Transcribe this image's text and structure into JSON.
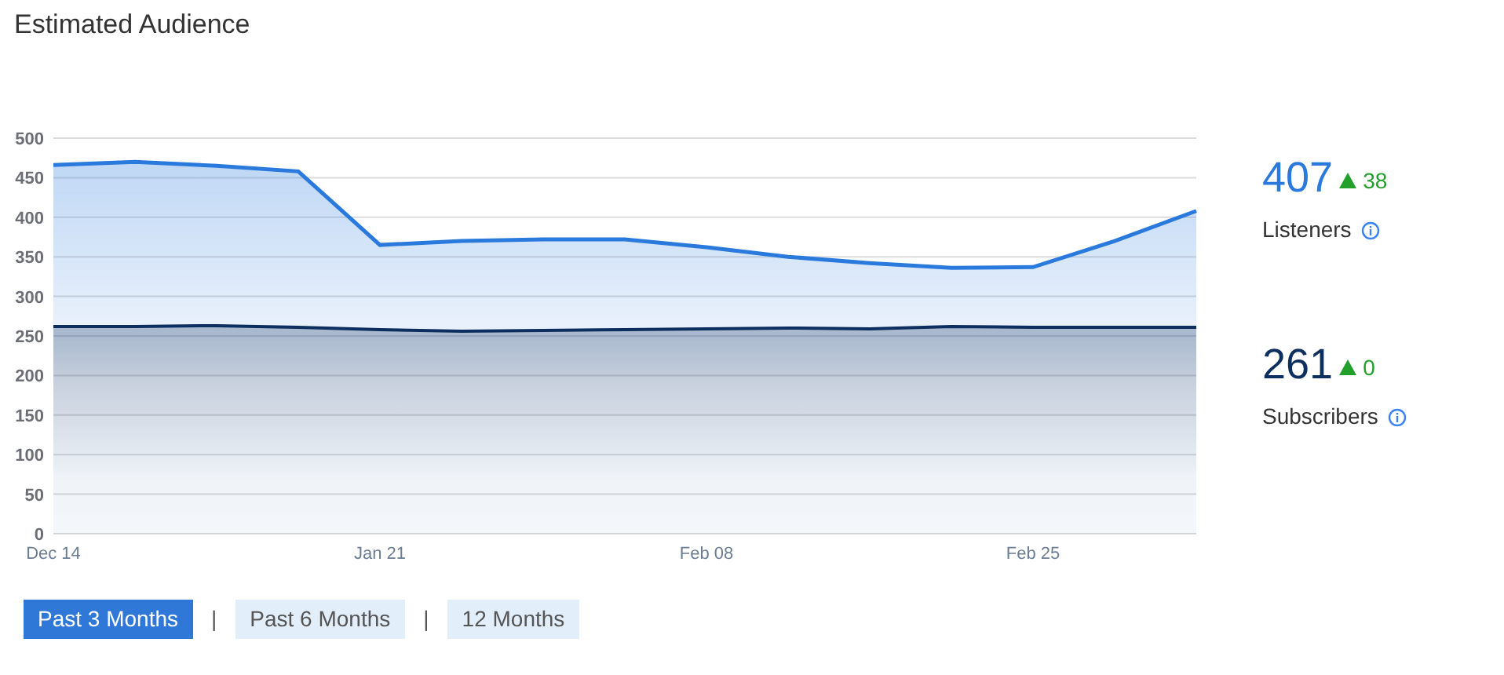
{
  "title": "Estimated Audience",
  "chart_data": {
    "type": "area",
    "categories": [
      "Dec 14",
      null,
      null,
      null,
      "Jan 21",
      null,
      null,
      null,
      "Feb 08",
      null,
      null,
      null,
      "Feb 25",
      null,
      null
    ],
    "series": [
      {
        "name": "Listeners",
        "color": "#2a7ade",
        "values": [
          466,
          470,
          465,
          458,
          365,
          370,
          372,
          372,
          362,
          350,
          342,
          336,
          337,
          370,
          408
        ]
      },
      {
        "name": "Subscribers",
        "color": "#0d2f5f",
        "values": [
          262,
          262,
          263,
          261,
          258,
          256,
          257,
          258,
          259,
          260,
          259,
          262,
          261,
          261,
          261
        ]
      }
    ],
    "ylim": [
      0,
      500
    ],
    "grid": true,
    "yticks": [
      0,
      50,
      100,
      150,
      200,
      250,
      300,
      350,
      400,
      450,
      500
    ]
  },
  "stats": [
    {
      "value": "407",
      "change": "38"
    },
    {
      "value": "261",
      "change": "0"
    }
  ],
  "ranges": [
    {
      "label": "Past 3 Months",
      "selected": true
    },
    {
      "label": "Past 6 Months",
      "selected": false
    },
    {
      "label": "12 Months",
      "selected": false
    }
  ],
  "separators": [
    "|",
    "|"
  ]
}
